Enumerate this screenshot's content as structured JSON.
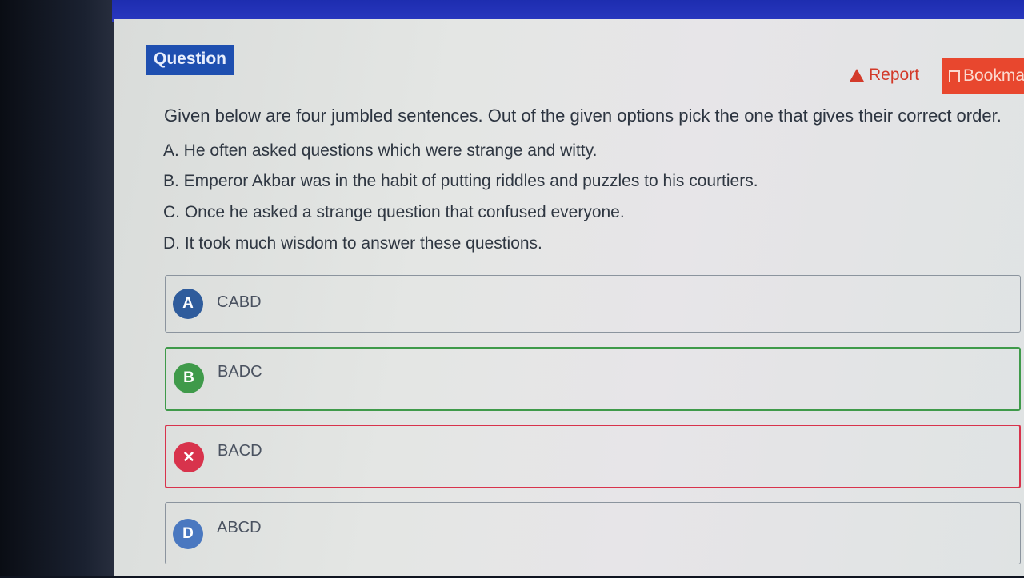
{
  "header": {
    "tag_label": "Question",
    "report_label": "Report",
    "bookmark_label": "Bookma"
  },
  "question": {
    "stem": "Given below are four jumbled sentences. Out of the given options pick the one that gives their correct order.",
    "sentences": [
      "A. He often asked questions which were strange and witty.",
      "B. Emperor Akbar was in the habit of putting riddles and puzzles to his courtiers.",
      "C. Once he asked a strange question that confused everyone.",
      "D. It took much wisdom to answer these questions."
    ]
  },
  "options": [
    {
      "badge": "A",
      "label": "CABD",
      "state": "neutral",
      "badge_color": "#2f5c9c"
    },
    {
      "badge": "B",
      "label": "BADC",
      "state": "correct",
      "badge_color": "#3f9a4a"
    },
    {
      "badge": "✕",
      "label": "BACD",
      "state": "wrong",
      "badge_color": "#d8334c"
    },
    {
      "badge": "D",
      "label": "ABCD",
      "state": "neutral",
      "badge_color": "#4a78c0"
    }
  ],
  "colors": {
    "top_bar": "#2a38c0",
    "question_tag": "#1e4fb0",
    "report": "#d33a2a",
    "bookmark": "#e8472e",
    "correct": "#3f9a4a",
    "wrong": "#d8334c"
  }
}
